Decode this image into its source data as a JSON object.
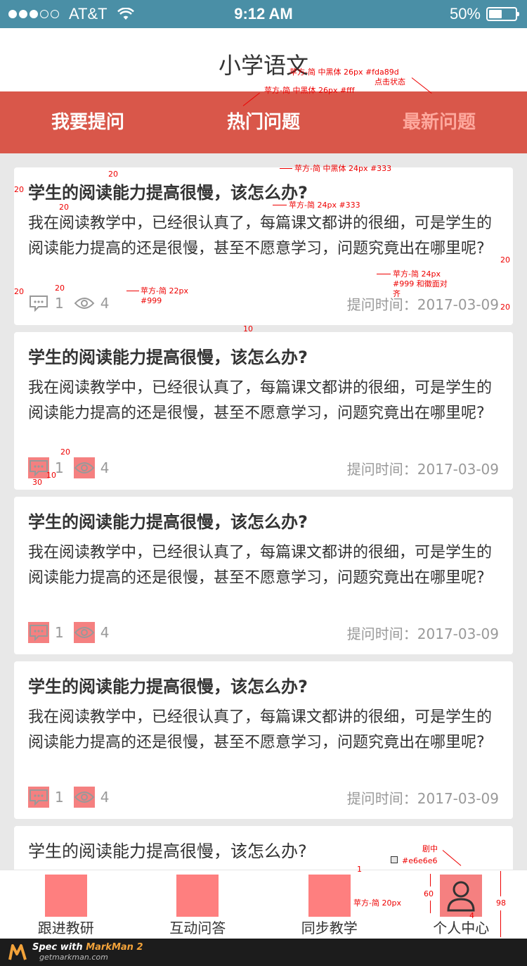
{
  "status_bar": {
    "carrier": "AT&T",
    "time": "9:12 AM",
    "battery": "50%",
    "battery_level": 0.5
  },
  "nav": {
    "title": "小学语文"
  },
  "tabs": [
    {
      "label": "我要提问"
    },
    {
      "label": "热门问题"
    },
    {
      "label": "最新问题"
    }
  ],
  "cards": [
    {
      "title": "学生的阅读能力提高很慢，该怎么办?",
      "body": "我在阅读教学中，已经很认真了，每篇课文都讲的很细，可是学生的阅读能力提高的还是很慢，甚至不愿意学习，问题究竟出在哪里呢?",
      "comments": "1",
      "views": "4",
      "time": "提问时间：2017-03-09"
    },
    {
      "title": "学生的阅读能力提高很慢，该怎么办?",
      "body": "我在阅读教学中，已经很认真了，每篇课文都讲的很细，可是学生的阅读能力提高的还是很慢，甚至不愿意学习，问题究竟出在哪里呢?",
      "comments": "1",
      "views": "4",
      "time": "提问时间：2017-03-09"
    },
    {
      "title": "学生的阅读能力提高很慢，该怎么办?",
      "body": "我在阅读教学中，已经很认真了，每篇课文都讲的很细，可是学生的阅读能力提高的还是很慢，甚至不愿意学习，问题究竟出在哪里呢?",
      "comments": "1",
      "views": "4",
      "time": "提问时间：2017-03-09"
    },
    {
      "title": "学生的阅读能力提高很慢，该怎么办?",
      "body": "我在阅读教学中，已经很认真了，每篇课文都讲的很细，可是学生的阅读能力提高的还是很慢，甚至不愿意学习，问题究竟出在哪里呢?",
      "comments": "1",
      "views": "4",
      "time": "提问时间：2017-03-09"
    },
    {
      "title": "学生的阅读能力提高很慢，该怎么办?"
    }
  ],
  "tabbar": [
    {
      "label": "跟进教研"
    },
    {
      "label": "互动问答"
    },
    {
      "label": "同步教学"
    },
    {
      "label": "个人中心"
    }
  ],
  "footer": {
    "prefix": "Spec with ",
    "brand": "MarkMan 2",
    "site": "getmarkman.com"
  },
  "annotations": {
    "a1": "苹方-简 中黑体 26px #fda89d",
    "a1b": "点击状态",
    "a2": "苹方-简 中黑体 26px #fff",
    "a3": "苹方-简 中黑体 24px #333",
    "a4": "苹方-简 24px #333",
    "a5": "苹方-简 24px",
    "a5b": "#999  和徽面对",
    "a5c": "齐",
    "a6": "苹方-简 22px",
    "a6b": "#999",
    "a7": "剧中",
    "a8": "#e6e6e6",
    "a9": "苹方-简  20px",
    "m20": "20",
    "m10": "10",
    "m30": "30",
    "m1": "1",
    "m60": "60",
    "m98": "98",
    "m4": "4"
  },
  "colors": {
    "tab_bg": "#d9574a",
    "tab_active": "#fda89d",
    "status_bg": "#4a8fa6",
    "placeholder": "#fe7f7f",
    "annotation": "#e00000"
  }
}
